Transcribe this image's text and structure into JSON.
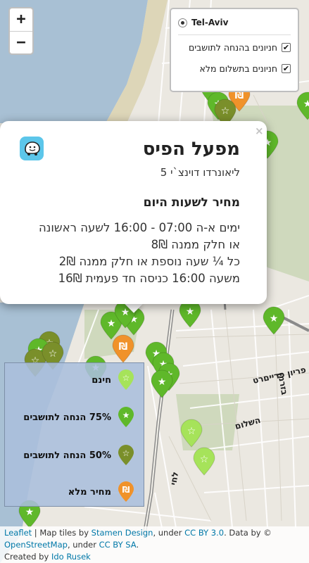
{
  "zoom": {
    "in_label": "+",
    "out_label": "−"
  },
  "layers": {
    "base": "Tel-Aviv",
    "overlays": [
      "חניונים בהנחה לתושבים",
      "חניונים בתשלום מלא"
    ],
    "overlay_checked": [
      "✔",
      "✔"
    ]
  },
  "popup": {
    "title": "מפעל הפיס",
    "address": "ליאונרדו דוינצ`י 5",
    "hours_heading": "מחיר לשעות היום",
    "lines": [
      "ימים א-ה 07:00 - 16:00 לשעה ראשונה",
      "או חלק ממנה 8₪",
      "כל ¼ שעה נוספת או חלק ממנה 2₪",
      "משעה 16:00 כניסה חד פעמית 16₪"
    ],
    "close": "×",
    "icon": "waze-icon"
  },
  "legend": [
    {
      "label": "חינם",
      "color": "#a6e35a",
      "icon": "star-outline-icon"
    },
    {
      "label": "75% הנחה לתושבים",
      "color": "#5fb82a",
      "icon": "star-half-icon"
    },
    {
      "label": "50% הנחה לתושבים",
      "color": "#7a8f2a",
      "icon": "star-empty-icon"
    },
    {
      "label": "מחיר מלא",
      "color": "#f0922a",
      "icon": "shekel-icon"
    }
  ],
  "map_labels": [
    {
      "text": "פריון פרייםרט",
      "kind": "street"
    },
    {
      "text": "בזרמן",
      "kind": "street"
    },
    {
      "text": "השלום",
      "kind": "street"
    },
    {
      "text": "לחי",
      "kind": "street"
    }
  ],
  "attribution": {
    "leaflet": "Leaflet",
    "t1": " | Map tiles by ",
    "stamen": "Stamen Design",
    "t2": ", under ",
    "ccby": "CC BY 3.0",
    "t3": ". Data by © ",
    "osm": "OpenStreetMap",
    "t4": ", under ",
    "ccbysa": "CC BY SA",
    "t5": ".",
    "created": "Created by ",
    "author": "Ido Rusek"
  },
  "colors": {
    "sea": "#a8c0d4",
    "land": "#ebe8e1",
    "park": "#cfd9bd",
    "road": "#ffffff",
    "major_road": "#9a9a9a"
  }
}
